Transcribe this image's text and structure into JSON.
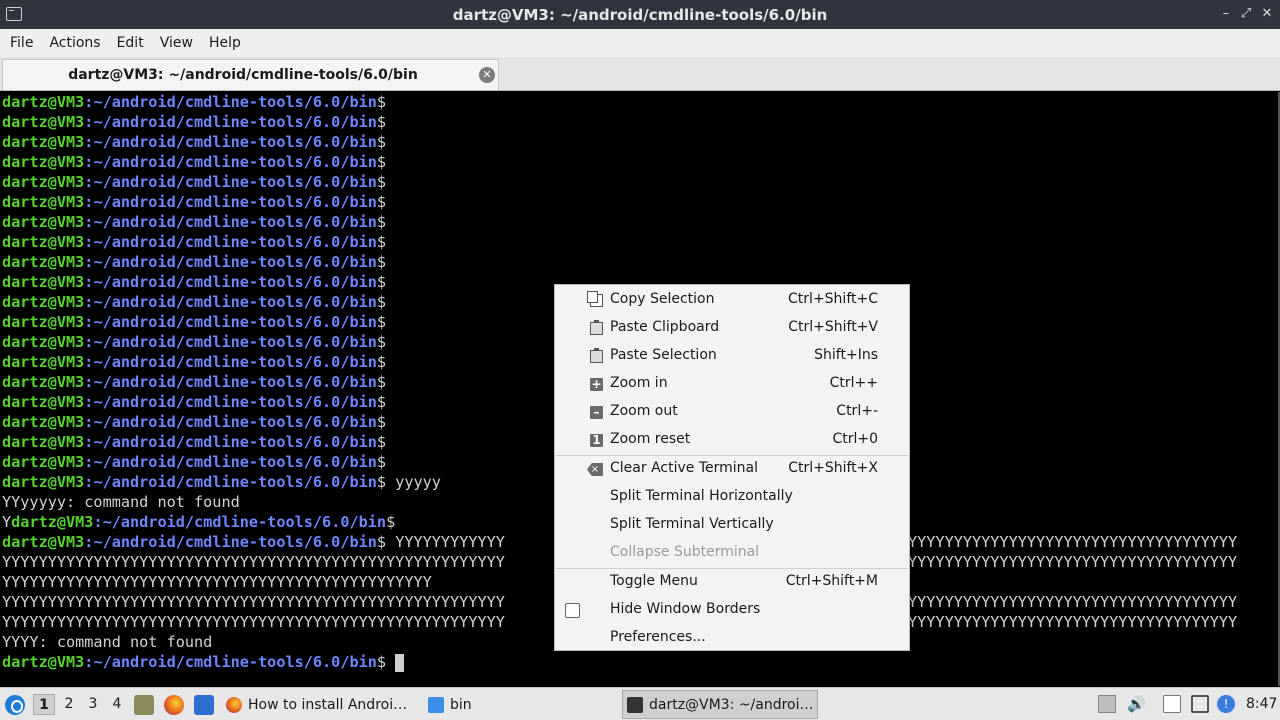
{
  "window": {
    "title": "dartz@VM3: ~/android/cmdline-tools/6.0/bin"
  },
  "menubar": {
    "items": [
      "File",
      "Actions",
      "Edit",
      "View",
      "Help"
    ]
  },
  "tab": {
    "label": "dartz@VM3: ~/android/cmdline-tools/6.0/bin"
  },
  "terminal": {
    "prompt_user": "dartz@VM3",
    "prompt_path": ":~/android/cmdline-tools/6.0/bin",
    "prompt_dollar": "$",
    "empty_prompt_count": 19,
    "lines": [
      {
        "type": "prompt",
        "text": " yyyyy"
      },
      {
        "type": "out",
        "text": "YYyyyyy: command not found"
      },
      {
        "type": "prompt",
        "prefix": "Y",
        "text": ""
      },
      {
        "type": "prompt",
        "text": " YYYYYYYYYYYY",
        "tail": "YYYYYYYYYYYYYYYYYYYYYYYYYYYYYYYYYYYY"
      },
      {
        "type": "out",
        "text": "YYYYYYYYYYYYYYYYYYYYYYYYYYYYYYYYYYYYYYYYYYYYYYYYYYYYYYY",
        "tail": "YYYYYYYYYYYYYYYYYYYYYYYYYYYYYYYYYYYY"
      },
      {
        "type": "out",
        "text": "YYYYYYYYYYYYYYYYYYYYYYYYYYYYYYYYYYYYYYYYYYYYYYY"
      },
      {
        "type": "out",
        "text": "YYYYYYYYYYYYYYYYYYYYYYYYYYYYYYYYYYYYYYYYYYYYYYYYYYYYYYY",
        "tail": "YYYYYYYYYYYYYYYYYYYYYYYYYYYYYYYYYYYY"
      },
      {
        "type": "out",
        "text": "YYYYYYYYYYYYYYYYYYYYYYYYYYYYYYYYYYYYYYYYYYYYYYYYYYYYYYY",
        "tail": "YYYYYYYYYYYYYYYYYYYYYYYYYYYYYYYYYYYY"
      },
      {
        "type": "out",
        "text": "YYYY: command not found"
      },
      {
        "type": "prompt",
        "text": " ",
        "cursor": true
      }
    ]
  },
  "context_menu": {
    "items": [
      {
        "label": "Copy Selection",
        "shortcut": "Ctrl+Shift+C",
        "icon": "copy-icon"
      },
      {
        "label": "Paste Clipboard",
        "shortcut": "Ctrl+Shift+V",
        "icon": "paste-icon"
      },
      {
        "label": "Paste Selection",
        "shortcut": "Shift+Ins",
        "icon": "paste-icon"
      },
      {
        "label": "Zoom in",
        "shortcut": "Ctrl++",
        "icon": "zoom-in-icon"
      },
      {
        "label": "Zoom out",
        "shortcut": "Ctrl+-",
        "icon": "zoom-out-icon"
      },
      {
        "label": "Zoom reset",
        "shortcut": "Ctrl+0",
        "icon": "zoom-reset-icon"
      },
      {
        "label": "Clear Active Terminal",
        "shortcut": "Ctrl+Shift+X",
        "icon": "clear-icon"
      },
      {
        "label": "Split Terminal Horizontally",
        "shortcut": ""
      },
      {
        "label": "Split Terminal Vertically",
        "shortcut": ""
      },
      {
        "label": "Collapse Subterminal",
        "shortcut": "",
        "disabled": true
      },
      {
        "label": "Toggle Menu",
        "shortcut": "Ctrl+Shift+M"
      },
      {
        "label": "Hide Window Borders",
        "shortcut": "",
        "checkbox": true,
        "checked": false
      },
      {
        "label": "Preferences...",
        "shortcut": ""
      }
    ]
  },
  "taskbar": {
    "workspaces": [
      "1",
      "2",
      "3",
      "4"
    ],
    "active_workspace": "1",
    "tasks": [
      {
        "label": "How to install Androi…",
        "icon": "firefox-icon"
      },
      {
        "label": "bin",
        "icon": "folder-icon"
      },
      {
        "label": "dartz@VM3: ~/androi…",
        "icon": "terminal-icon",
        "active": true
      }
    ],
    "clock": "8:47"
  },
  "colors": {
    "prompt_user": "#56d22e",
    "prompt_path": "#6f86ff",
    "titlebar_bg": "#2f343f"
  }
}
